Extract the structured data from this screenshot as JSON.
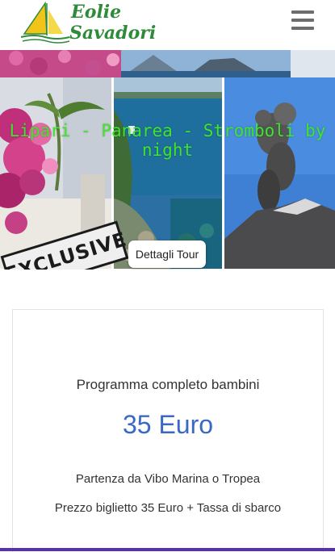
{
  "header": {
    "logo_line1": "Eolie",
    "logo_line2": "Savadori"
  },
  "hero": {
    "title": "Lipari - Panarea - Stromboli by night",
    "details_button": "Dettagli Tour",
    "stamp_text": "EXCLUSIVE"
  },
  "card": {
    "title": "Programma completo bambini",
    "price": "35 Euro",
    "departure": "Partenza da Vibo Marina o Tropea",
    "ticket": "Prezzo biglietto 35 Euro + Tassa di sbarco"
  },
  "colors": {
    "logo_green": "#2e8b3a",
    "hero_title_green": "#3ee62b",
    "price_blue": "#3a68c8",
    "bottom_accent": "#5a2fb0"
  },
  "icons": {
    "menu": "hamburger-menu-icon",
    "logo": "sailboat-logo-icon"
  }
}
